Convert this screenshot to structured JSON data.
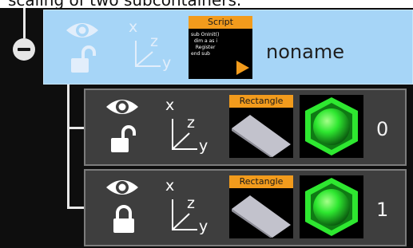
{
  "header": {
    "caption": "scaling of two subcontainers."
  },
  "root": {
    "name": "noname",
    "script_tile": {
      "label": "Script",
      "code": "sub OnInit()\n  dim a as i\n   Register\nend sub"
    }
  },
  "children": [
    {
      "index": "0",
      "lock_state": "unlocked",
      "geometry_label": "Rectangle"
    },
    {
      "index": "1",
      "lock_state": "locked",
      "geometry_label": "Rectangle"
    }
  ],
  "axis_labels": {
    "x": "x",
    "y": "y",
    "z": "z"
  },
  "colors": {
    "selected_row": "#a6d5f7",
    "child_row": "#3e3e3e",
    "tile_label": "#f29b1c",
    "material_green": "#2ee830"
  },
  "icons": [
    "collapse-icon",
    "eye-icon",
    "unlocked-padlock-icon",
    "locked-padlock-icon",
    "axes-icon",
    "rectangle-geometry-icon",
    "material-sphere-icon",
    "play-icon"
  ]
}
